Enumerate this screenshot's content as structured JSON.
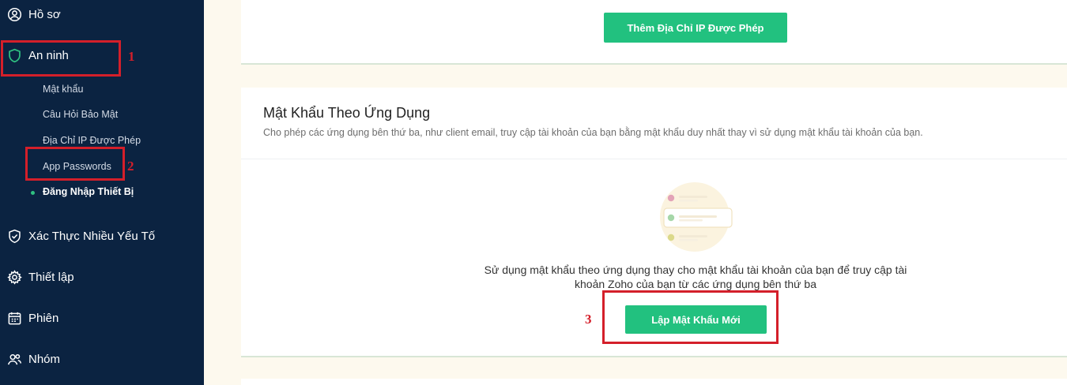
{
  "sidebar": {
    "items": [
      {
        "label": "Hồ sơ",
        "icon": "user-circle-icon"
      },
      {
        "label": "An ninh",
        "icon": "shield-icon"
      },
      {
        "label": "Xác Thực Nhiều Yếu Tố",
        "icon": "shield-check-icon"
      },
      {
        "label": "Thiết lập",
        "icon": "gear-icon"
      },
      {
        "label": "Phiên",
        "icon": "calendar-icon"
      },
      {
        "label": "Nhóm",
        "icon": "users-icon"
      }
    ],
    "security_subitems": [
      {
        "label": "Mật khẩu"
      },
      {
        "label": "Câu Hỏi Bảo Mật"
      },
      {
        "label": "Địa Chỉ IP Được Phép"
      },
      {
        "label": "App Passwords"
      },
      {
        "label": "Đăng Nhập Thiết Bị",
        "active": true
      }
    ]
  },
  "ip_section": {
    "add_button": "Thêm Địa Chỉ IP Được Phép"
  },
  "app_passwords": {
    "title": "Mật Khẩu Theo Ứng Dụng",
    "description": "Cho phép các ứng dụng bên thứ ba, như client email, truy cập tài khoản của bạn bằng mật khẩu duy nhất thay vì sử dụng mật khẩu tài khoản của bạn.",
    "empty_line1": "Sử dụng mật khẩu theo ứng dụng thay cho mật khẩu tài khoản của bạn để truy cập tài",
    "empty_line2": "khoản Zoho của bạn từ các ứng dụng bên thứ ba",
    "create_button": "Lập Mật Khẩu Mới"
  },
  "annotations": [
    "1",
    "2",
    "3"
  ],
  "colors": {
    "sidebar_bg": "#0b2341",
    "accent_green": "#22c17f",
    "annotation_red": "#d41f2a",
    "page_bg": "#fdf9ee"
  }
}
